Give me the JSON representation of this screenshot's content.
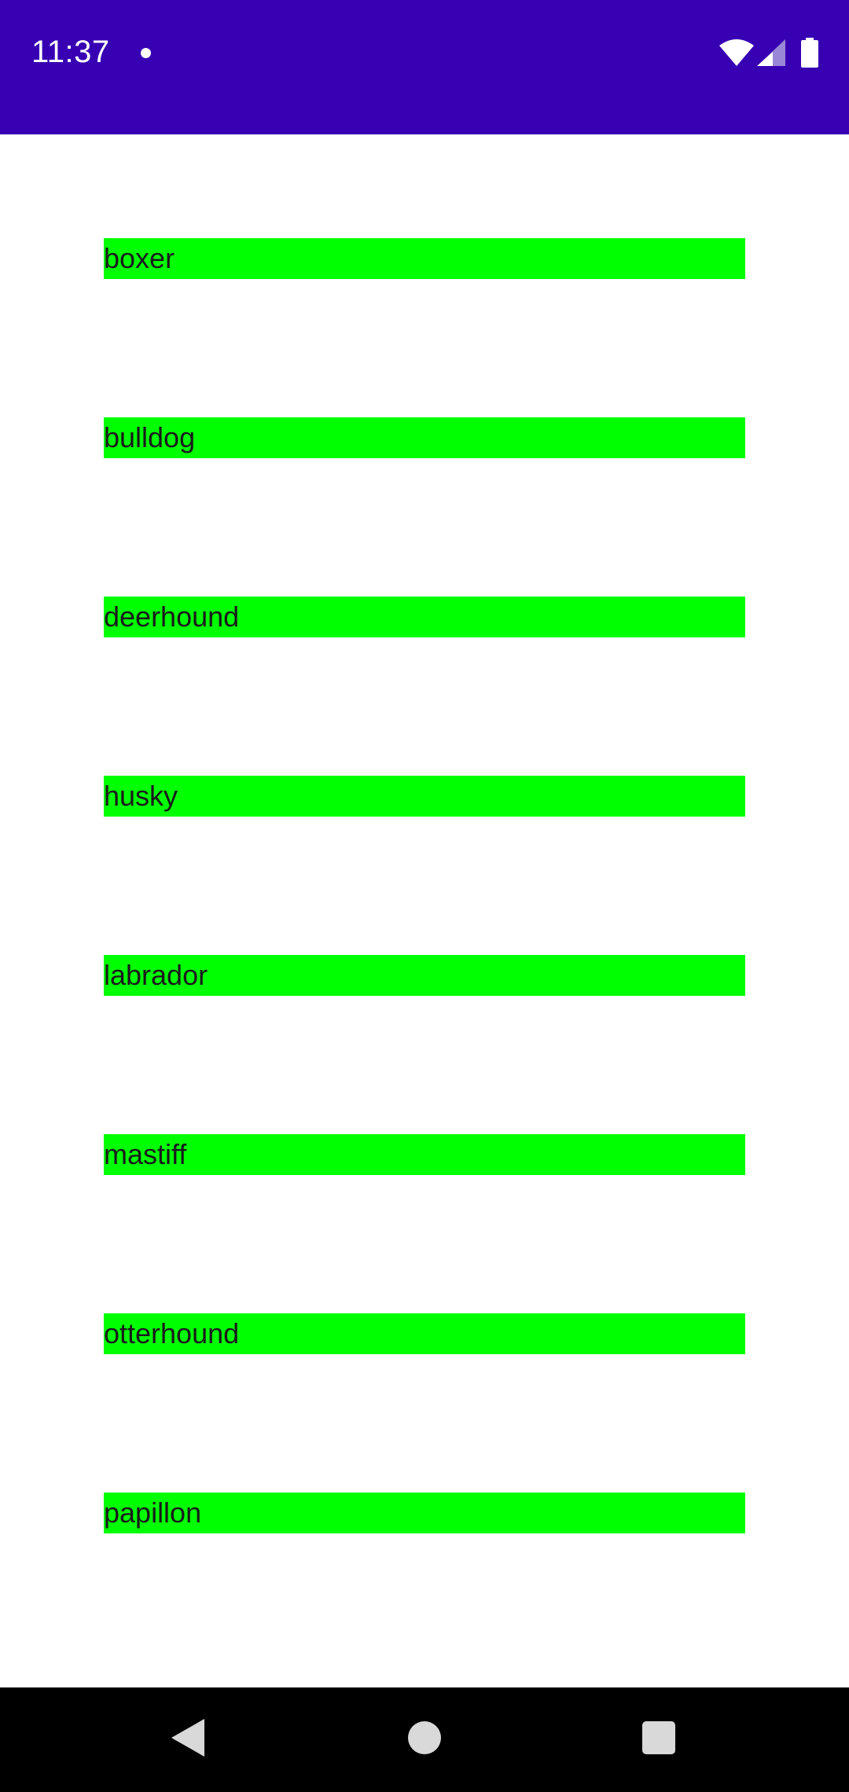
{
  "status_bar": {
    "time": "11:37",
    "background_color": "#3700b3",
    "icons": [
      "notification-dot-icon",
      "wifi-icon",
      "signal-icon",
      "battery-icon"
    ]
  },
  "list": {
    "item_background_color": "#00ff00",
    "items": [
      {
        "label": "boxer"
      },
      {
        "label": "bulldog"
      },
      {
        "label": "deerhound"
      },
      {
        "label": "husky"
      },
      {
        "label": "labrador"
      },
      {
        "label": "mastiff"
      },
      {
        "label": "otterhound"
      },
      {
        "label": "papillon"
      }
    ]
  },
  "nav_bar": {
    "buttons": [
      "back-icon",
      "home-icon",
      "recents-icon"
    ]
  }
}
